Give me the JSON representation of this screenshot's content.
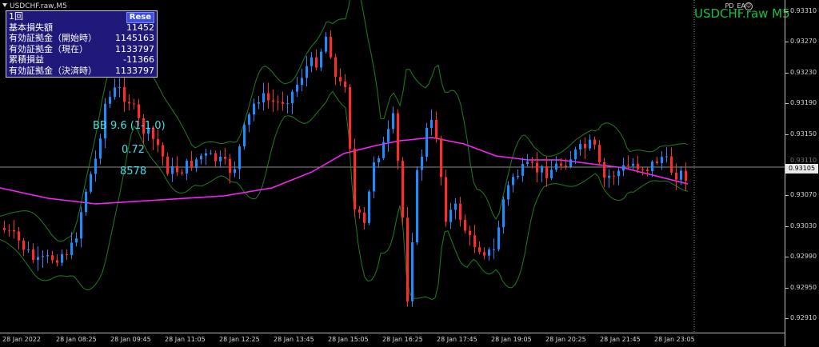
{
  "window": {
    "title": "USDCHF.raw,M5",
    "symbol_watermark": "USDCHF.raw M5",
    "ea_label": "PD_EA",
    "ea_icon": "smiley-icon"
  },
  "info_panel": {
    "reset_label": "Rese",
    "rows": [
      {
        "label": "1回",
        "value": ""
      },
      {
        "label": "基本損失額",
        "value": "11452"
      },
      {
        "label": "有効証拠金（開始時）",
        "value": "1145163"
      },
      {
        "label": "有効証拠金（現在）",
        "value": "1133797"
      },
      {
        "label": "累積損益",
        "value": "-11366"
      },
      {
        "label": "有効証拠金（決済時）",
        "value": "1133797"
      }
    ]
  },
  "indicator_text": {
    "bb": "BB 9.6 (1-1.0)",
    "ratio": "0.72",
    "count": "8578"
  },
  "price_axis": {
    "labels": [
      "0.93310",
      "0.93270",
      "0.93230",
      "0.93190",
      "0.93150",
      "0.93110",
      "0.93070",
      "0.93030",
      "0.92990",
      "0.92950",
      "0.92910"
    ],
    "current_price": "0.93105"
  },
  "time_axis": {
    "labels": [
      "28 Jan 2022",
      "28 Jan 08:25",
      "28 Jan 09:45",
      "28 Jan 11:05",
      "28 Jan 12:25",
      "28 Jan 13:45",
      "28 Jan 15:05",
      "28 Jan 16:25",
      "28 Jan 17:45",
      "28 Jan 19:05",
      "28 Jan 20:25",
      "28 Jan 21:45",
      "28 Jan 23:05"
    ]
  },
  "colors": {
    "bull": "#1e8bff",
    "bear": "#ff2a2a",
    "ma": "#ff22ff",
    "bands": "#1f7f1f",
    "watermark": "#13c13b",
    "indicator_text": "#40e0e8",
    "panel_bg": "#1f1a7a"
  }
}
